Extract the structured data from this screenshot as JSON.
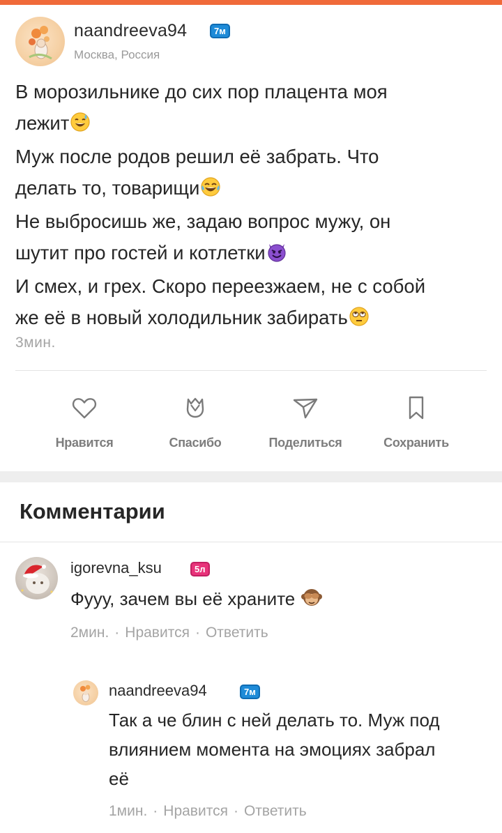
{
  "post": {
    "author": "naandreeva94",
    "author_badge": "7м",
    "location": "Москва, Россия",
    "lines": [
      "В морозильнике до сих пор плацента моя",
      "лежит",
      "Муж после родов решил её забрать. Что",
      "делать то, товарищи",
      "Не выбросишь же, задаю вопрос мужу, он",
      "шутит про гостей и котлетки",
      "И смех, и грех. Скоро переезжаем, не с собой",
      "же её в новый холодильник забирать"
    ],
    "emoji_icons": [
      "sweat-smile-emoji-icon",
      "tears-of-joy-emoji-icon",
      "smiling-devil-emoji-icon",
      "eye-roll-emoji-icon"
    ],
    "time": "3мин."
  },
  "actions": {
    "like": "Нравится",
    "thanks": "Спасибо",
    "share": "Поделиться",
    "save": "Сохранить"
  },
  "comments_title": "Комментарии",
  "comments": [
    {
      "author": "igorevna_ksu",
      "badge": "5л",
      "text": "Фууу, зачем вы её храните",
      "time": "2мин.",
      "like": "Нравится",
      "reply": "Ответить"
    },
    {
      "author": "naandreeva94",
      "badge": "7м",
      "lines": [
        "Так а че блин с ней делать то. Муж под",
        "влиянием момента на эмоциях забрал",
        "её"
      ],
      "time": "1мин.",
      "like": "Нравится",
      "reply": "Ответить"
    }
  ],
  "separator": "·",
  "colors": {
    "accent": "#f06a3a",
    "badge_blue": "#1e8bd8",
    "badge_pink": "#e8337a",
    "muted": "#a4a4a4"
  }
}
